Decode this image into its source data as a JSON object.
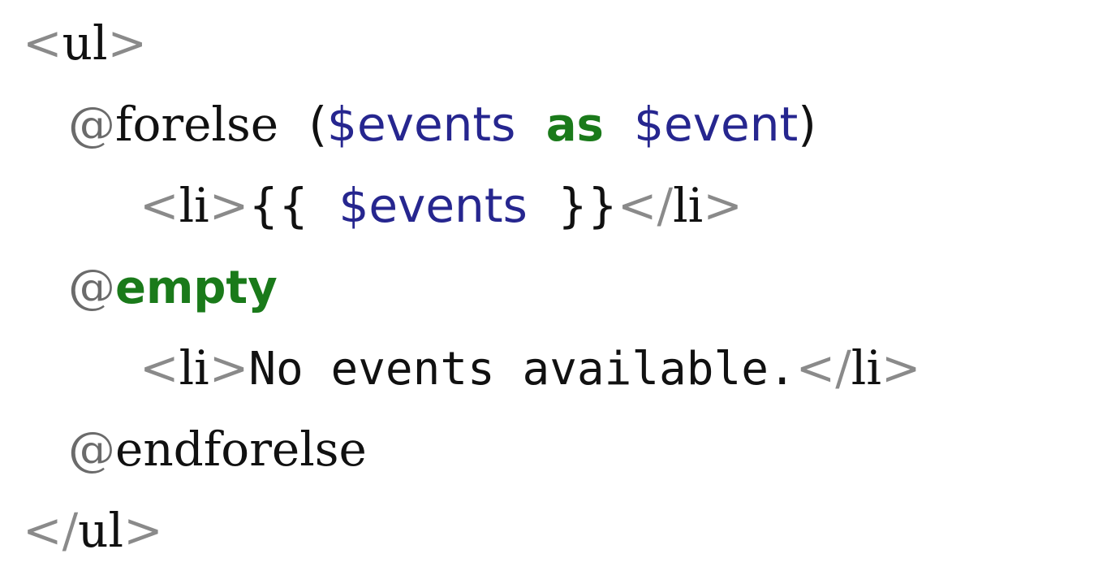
{
  "snippet": {
    "language": "blade",
    "background_color": "#ffffff",
    "colors": {
      "punctuation": "#8a8a8a",
      "tag_name": "#111111",
      "at_sign": "#6b6b6b",
      "directive": "#111111",
      "keyword": "#1a7a1a",
      "variable": "#26268f",
      "brace": "#111111",
      "text": "#111111"
    },
    "lines": [
      {
        "number": 1,
        "indent": 0,
        "text": "<ul>",
        "tokens": [
          {
            "t": "<",
            "k": "punct"
          },
          {
            "t": "ul",
            "k": "tag"
          },
          {
            "t": ">",
            "k": "punct"
          }
        ]
      },
      {
        "number": 2,
        "indent": 1,
        "text": "@forelse ($events as $event)",
        "tokens": [
          {
            "t": "@",
            "k": "at"
          },
          {
            "t": "forelse",
            "k": "directive"
          },
          {
            "t": " ",
            "k": "space"
          },
          {
            "t": "(",
            "k": "brace"
          },
          {
            "t": "$events",
            "k": "var"
          },
          {
            "t": " ",
            "k": "space"
          },
          {
            "t": "as",
            "k": "keyword"
          },
          {
            "t": " ",
            "k": "space"
          },
          {
            "t": "$event",
            "k": "var"
          },
          {
            "t": ")",
            "k": "brace"
          }
        ]
      },
      {
        "number": 3,
        "indent": 2,
        "text": "<li>{{ $events }}</li>",
        "tokens": [
          {
            "t": "<",
            "k": "punct"
          },
          {
            "t": "li",
            "k": "tag"
          },
          {
            "t": ">",
            "k": "punct"
          },
          {
            "t": "{{",
            "k": "brace"
          },
          {
            "t": " ",
            "k": "space"
          },
          {
            "t": "$events",
            "k": "var"
          },
          {
            "t": " ",
            "k": "space"
          },
          {
            "t": "}}",
            "k": "brace"
          },
          {
            "t": "<",
            "k": "punct"
          },
          {
            "t": "/",
            "k": "punct"
          },
          {
            "t": "li",
            "k": "tag"
          },
          {
            "t": ">",
            "k": "punct"
          }
        ]
      },
      {
        "number": 4,
        "indent": 1,
        "text": "@empty",
        "tokens": [
          {
            "t": "@",
            "k": "at"
          },
          {
            "t": "empty",
            "k": "keyword"
          }
        ]
      },
      {
        "number": 5,
        "indent": 2,
        "text": "<li>No events available.</li>",
        "tokens": [
          {
            "t": "<",
            "k": "punct"
          },
          {
            "t": "li",
            "k": "tag"
          },
          {
            "t": ">",
            "k": "punct"
          },
          {
            "t": "No events available.",
            "k": "text"
          },
          {
            "t": "<",
            "k": "punct"
          },
          {
            "t": "/",
            "k": "punct"
          },
          {
            "t": "li",
            "k": "tag"
          },
          {
            "t": ">",
            "k": "punct"
          }
        ]
      },
      {
        "number": 6,
        "indent": 1,
        "text": "@endforelse",
        "tokens": [
          {
            "t": "@",
            "k": "at"
          },
          {
            "t": "endforelse",
            "k": "directive"
          }
        ]
      },
      {
        "number": 7,
        "indent": 0,
        "text": "</ul>",
        "tokens": [
          {
            "t": "<",
            "k": "punct"
          },
          {
            "t": "/",
            "k": "punct"
          },
          {
            "t": "ul",
            "k": "tag"
          },
          {
            "t": ">",
            "k": "punct"
          }
        ]
      }
    ]
  }
}
